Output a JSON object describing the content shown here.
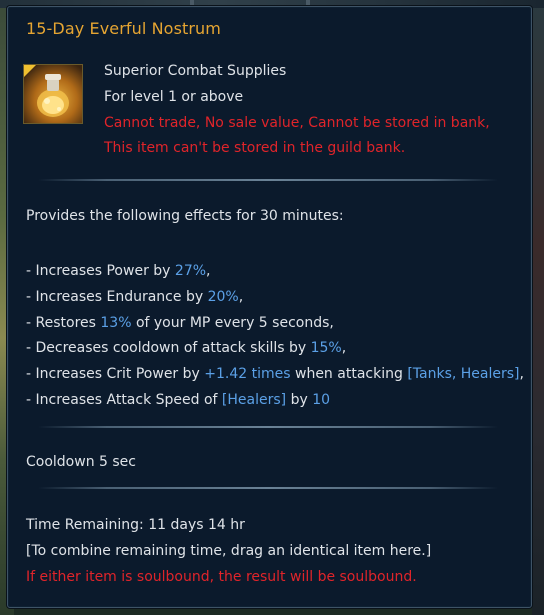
{
  "item": {
    "title": "15-Day Everful Nostrum",
    "icon": "potion-flask-icon",
    "category": "Superior Combat Supplies",
    "level_req": "For level 1 or above",
    "restriction_1": "Cannot trade, No sale value, Cannot be stored in bank,",
    "restriction_2": "This item can't be stored in the guild bank."
  },
  "effects": {
    "header": "Provides the following effects for 30 minutes:",
    "lines": [
      {
        "pre": "- Increases Power by ",
        "val": "27%",
        "post": ","
      },
      {
        "pre": "- Increases Endurance by ",
        "val": "20%",
        "post": ","
      },
      {
        "pre": "- Restores ",
        "val": "13%",
        "post": " of your MP every 5 seconds,"
      },
      {
        "pre": "- Decreases cooldown of attack skills by ",
        "val": "15%",
        "post": ","
      },
      {
        "pre": "- Increases Crit Power by ",
        "val": "+1.42 times",
        "mid": " when attacking ",
        "val2": "[Tanks, Healers]",
        "post": ","
      },
      {
        "pre": "- Increases Attack Speed of ",
        "val": "[Healers]",
        "mid": " by ",
        "val2": "10",
        "post": ""
      }
    ]
  },
  "cooldown": "Cooldown  5 sec",
  "time": {
    "remaining": "Time Remaining: 11 days 14 hr",
    "combine_hint": "[To combine remaining time, drag an identical item here.]",
    "soulbound_warning": "If either item is soulbound, the result will be soulbound."
  },
  "colors": {
    "title": "#e6a532",
    "text": "#dfe3e8",
    "warning": "#e0242a",
    "value": "#5ba0e6",
    "panel_bg": "#0b1a2c"
  }
}
